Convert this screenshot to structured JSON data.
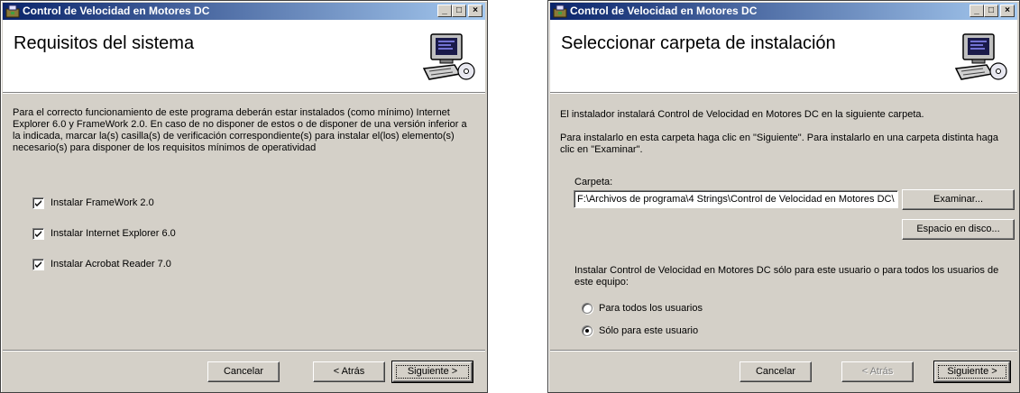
{
  "window1": {
    "title": "Control de Velocidad en Motores DC",
    "header_title": "Requisitos del sistema",
    "description": "Para el correcto funcionamiento de este programa deberán estar instalados (como mínimo) Internet Explorer 6.0 y FrameWork 2.0. En caso de no disponer de estos o de disponer de una versión inferior a la indicada, marcar la(s) casilla(s) de verificación correspondiente(s) para instalar el(los) elemento(s) necesario(s) para disponer de los requisitos mínimos de operatividad",
    "checkboxes": [
      {
        "label": "Instalar FrameWork 2.0",
        "checked": true
      },
      {
        "label": "Instalar Internet Explorer 6.0",
        "checked": true
      },
      {
        "label": "Instalar Acrobat Reader 7.0",
        "checked": true
      }
    ],
    "buttons": {
      "cancel": "Cancelar",
      "back": "< Atrás",
      "next": "Siguiente >"
    }
  },
  "window2": {
    "title": "Control de Velocidad en Motores DC",
    "header_title": "Seleccionar carpeta de instalación",
    "intro": "El instalador instalará Control de Velocidad en Motores DC en la siguiente carpeta.",
    "instructions": "Para instalarlo en esta carpeta haga clic en \"Siguiente\". Para instalarlo en una carpeta distinta haga clic en \"Examinar\".",
    "folder_label": "Carpeta:",
    "folder_value": "F:\\Archivos de programa\\4 Strings\\Control de Velocidad en Motores DC\\",
    "browse_button": "Examinar...",
    "disk_space_button": "Espacio en disco...",
    "scope_question": "Instalar Control de Velocidad en Motores DC sólo para este usuario o para todos los usuarios de este equipo:",
    "radios": [
      {
        "label": "Para todos los usuarios",
        "selected": false
      },
      {
        "label": "Sólo para este usuario",
        "selected": true
      }
    ],
    "buttons": {
      "cancel": "Cancelar",
      "back": "< Atrás",
      "next": "Siguiente >",
      "back_enabled": false
    }
  },
  "colors": {
    "titlebar_start": "#0a246a",
    "titlebar_end": "#a6caf0",
    "face": "#d4d0c8"
  },
  "icons": [
    "installer-app-icon",
    "computer-setup-icon",
    "minimize-icon",
    "maximize-icon",
    "close-icon"
  ]
}
